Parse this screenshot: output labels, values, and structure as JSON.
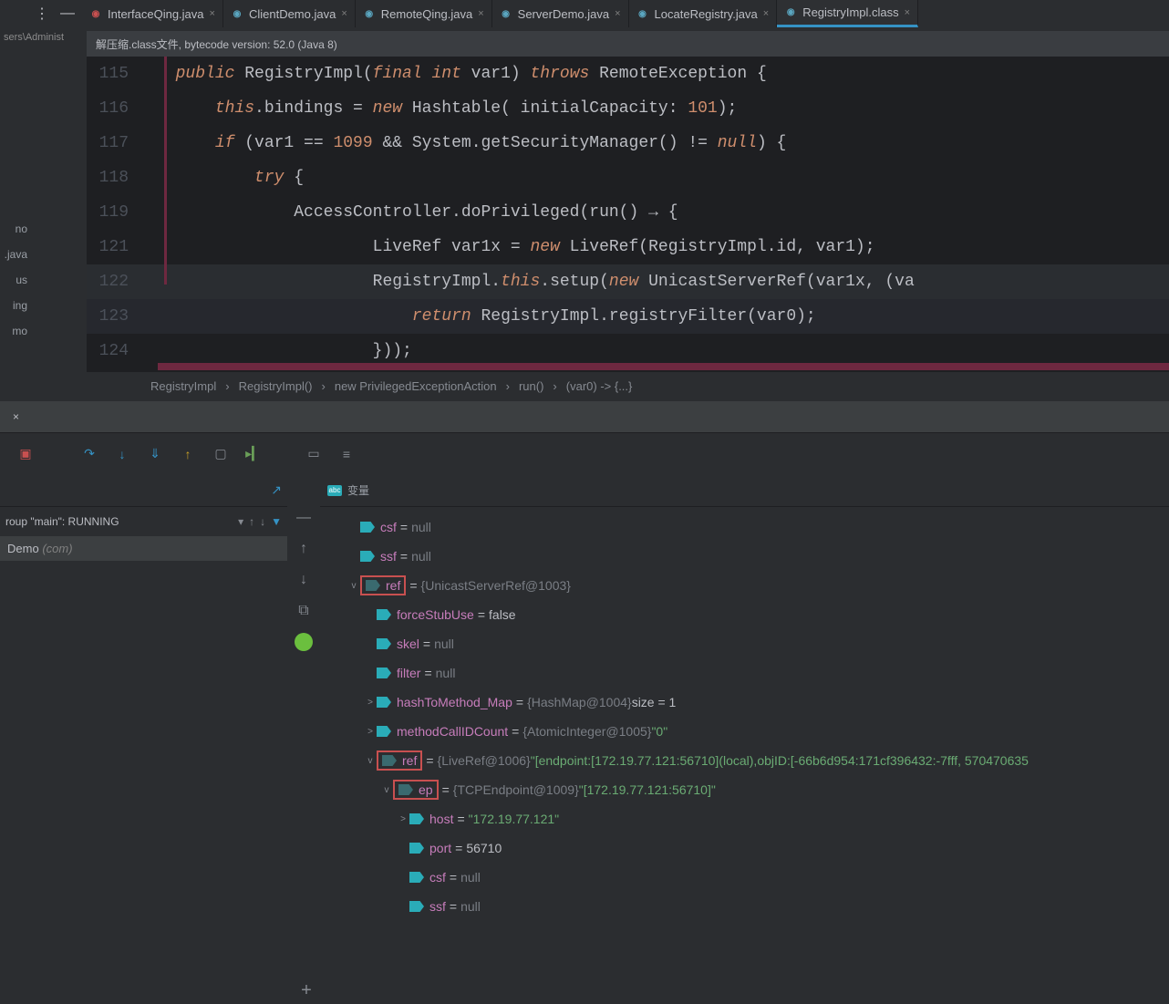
{
  "top_icons": {
    "more": "⋮",
    "minimize": "—"
  },
  "tabs": [
    {
      "label": "InterfaceQing.java",
      "icon_color": "red"
    },
    {
      "label": "ClientDemo.java",
      "icon_color": "blue"
    },
    {
      "label": "RemoteQing.java",
      "icon_color": "blue"
    },
    {
      "label": "ServerDemo.java",
      "icon_color": "blue"
    },
    {
      "label": "LocateRegistry.java",
      "icon_color": "blue"
    },
    {
      "label": "RegistryImpl.class",
      "icon_color": "blue",
      "active": true
    }
  ],
  "path_crumb": "sers\\Administ",
  "info_banner": "解压缩.class文件, bytecode version: 52.0 (Java 8)",
  "sidebar_truncated": [
    "no",
    ".java",
    "us",
    "ing",
    "mo"
  ],
  "editor": {
    "lines": [
      {
        "num": "115",
        "text_html": "<span class='kw'>public</span> RegistryImpl(<span class='kw'>final int</span> var1) <span class='kw'>throws</span> RemoteException {"
      },
      {
        "num": "116",
        "text_html": "    <span class='kw'>this</span>.bindings = <span class='kw'>new</span> Hashtable( initialCapacity: <span class='num2'>101</span>);"
      },
      {
        "num": "117",
        "text_html": "    <span class='kw'>if</span> (var1 == <span class='num2'>1099</span> && System.getSecurityManager() != <span class='kw'>null</span>) {"
      },
      {
        "num": "118",
        "text_html": "        <span class='kw'>try</span> {"
      },
      {
        "num": "119",
        "text_html": "            AccessController.doPrivileged(run() → {"
      },
      {
        "num": "121",
        "text_html": "                    LiveRef var1x = <span class='kw'>new</span> LiveRef(RegistryImpl.id, var1);"
      },
      {
        "num": "122",
        "text_html": "                    RegistryImpl.<span class='kw'>this</span>.setup(<span class='kw'>new</span> UnicastServerRef(var1x, (va",
        "class": "line122"
      },
      {
        "num": "123",
        "text_html": "                        <span class='kw'>return</span> RegistryImpl.registryFilter(var0);",
        "class": "active"
      },
      {
        "num": "124",
        "text_html": "                    }));"
      }
    ]
  },
  "breadcrumb": [
    "RegistryImpl",
    "RegistryImpl()",
    "new PrivilegedExceptionAction",
    "run()",
    "(var0) -> {...}"
  ],
  "tw_tab_close": "×",
  "panel_left": {
    "frames_label": "roup \"main\": RUNNING",
    "stack_main": "Demo",
    "stack_pkg": "(com)"
  },
  "vars_header": "变量",
  "blue_plus": "+",
  "variables": [
    {
      "indent": 0,
      "chevron": "",
      "name": "csf",
      "eq": " = ",
      "val": "null",
      "valClass": "var-val-obj"
    },
    {
      "indent": 0,
      "chevron": "",
      "name": "ssf",
      "eq": " = ",
      "val": "null",
      "valClass": "var-val-obj"
    },
    {
      "indent": 0,
      "chevron": "v",
      "name": "ref",
      "eq": " = ",
      "val": "{UnicastServerRef@1003}",
      "valClass": "var-val-obj",
      "redbox": true,
      "ghost": true
    },
    {
      "indent": 1,
      "chevron": "",
      "name": "forceStubUse",
      "eq": " = ",
      "val": "false",
      "valClass": "var-val-num"
    },
    {
      "indent": 1,
      "chevron": "",
      "name": "skel",
      "eq": " = ",
      "val": "null",
      "valClass": "var-val-obj"
    },
    {
      "indent": 1,
      "chevron": "",
      "name": "filter",
      "eq": " = ",
      "val": "null",
      "valClass": "var-val-obj"
    },
    {
      "indent": 1,
      "chevron": ">",
      "name": "hashToMethod_Map",
      "eq": " = ",
      "val": "{HashMap@1004}",
      "valClass": "var-val-obj",
      "suffix": "  size = 1"
    },
    {
      "indent": 1,
      "chevron": ">",
      "name": "methodCallIDCount",
      "eq": " = ",
      "val": "{AtomicInteger@1005}",
      "valClass": "var-val-obj",
      "strSuffix": " \"0\""
    },
    {
      "indent": 1,
      "chevron": "v",
      "name": "ref",
      "eq": " = ",
      "val": "{LiveRef@1006}",
      "valClass": "var-val-obj",
      "strSuffix": " \"[endpoint:[172.19.77.121:56710](local),objID:[-66b6d954:171cf396432:-7fff, 570470635",
      "redbox": true,
      "ghost": true
    },
    {
      "indent": 2,
      "chevron": "v",
      "name": "ep",
      "eq": " = ",
      "val": "{TCPEndpoint@1009}",
      "valClass": "var-val-obj",
      "strSuffix": " \"[172.19.77.121:56710]\"",
      "redbox": true,
      "ghost": true
    },
    {
      "indent": 3,
      "chevron": ">",
      "name": "host",
      "eq": " = ",
      "strVal": "\"172.19.77.121\""
    },
    {
      "indent": 3,
      "chevron": "",
      "name": "port",
      "eq": " = ",
      "val": "56710",
      "valClass": "var-val-num"
    },
    {
      "indent": 3,
      "chevron": "",
      "name": "csf",
      "eq": " = ",
      "val": "null",
      "valClass": "var-val-obj"
    },
    {
      "indent": 3,
      "chevron": "",
      "name": "ssf",
      "eq": " = ",
      "val": "null",
      "valClass": "var-val-obj"
    }
  ]
}
